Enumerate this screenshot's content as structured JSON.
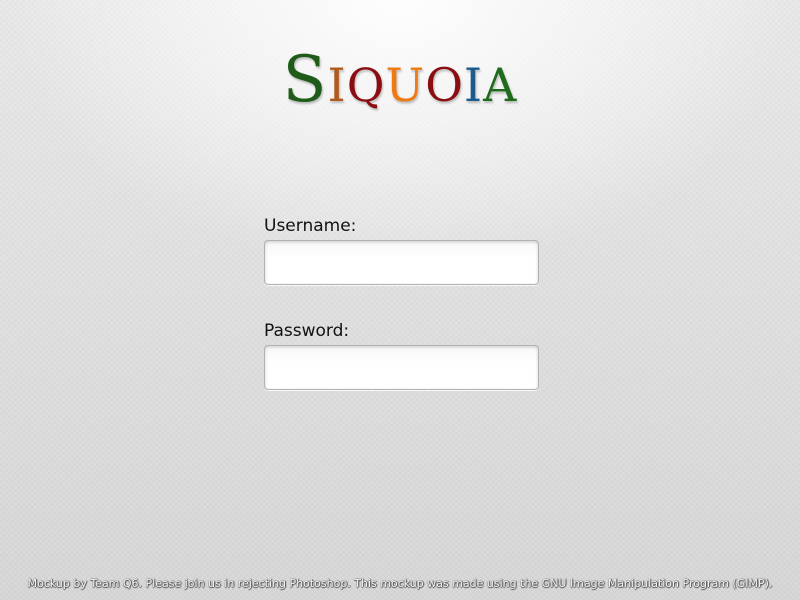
{
  "logo": {
    "letters": [
      {
        "char": "S",
        "color": "#1f5c1a",
        "size": "big"
      },
      {
        "char": "I",
        "color": "#b05a1e",
        "size": "small"
      },
      {
        "char": "Q",
        "color": "#8a0d12",
        "size": "small"
      },
      {
        "char": "U",
        "color": "#f07a12",
        "size": "small"
      },
      {
        "char": "O",
        "color": "#8a0d12",
        "size": "small"
      },
      {
        "char": "I",
        "color": "#1b5a8c",
        "size": "small"
      },
      {
        "char": "A",
        "color": "#1f6b1c",
        "size": "small"
      }
    ]
  },
  "login": {
    "username_label": "Username:",
    "username_value": "",
    "password_label": "Password:",
    "password_value": ""
  },
  "footer": {
    "text": "Mockup by Team Q6. Please join us in rejecting Photoshop. This mockup was made using the GNU Image Manipulation Program (GIMP)."
  }
}
